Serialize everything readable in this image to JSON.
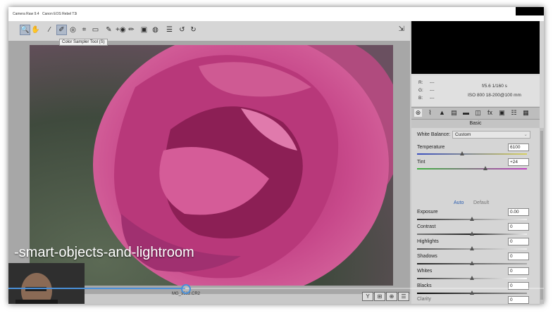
{
  "window": {
    "app_title": "Camera Raw 9.4",
    "camera_title": "Canon EOS Rebel T3i"
  },
  "toolbar": {
    "tools": [
      {
        "name": "zoom-tool-icon",
        "glyph": "🔍",
        "active": true
      },
      {
        "name": "hand-tool-icon",
        "glyph": "✋",
        "active": false
      },
      {
        "name": "white-balance-tool-icon",
        "glyph": "⁄",
        "active": false
      },
      {
        "name": "color-sampler-tool-icon",
        "glyph": "✐",
        "active": true
      },
      {
        "name": "targeted-adjustment-tool-icon",
        "glyph": "◎",
        "active": false
      },
      {
        "name": "crop-tool-icon",
        "glyph": "⌗",
        "active": false
      },
      {
        "name": "straighten-tool-icon",
        "glyph": "▭",
        "active": false
      },
      {
        "name": "spot-removal-tool-icon",
        "glyph": "✎",
        "active": false
      },
      {
        "name": "red-eye-tool-icon",
        "glyph": "+◉",
        "active": false
      },
      {
        "name": "adjustment-brush-icon",
        "glyph": "✏",
        "active": false
      },
      {
        "name": "graduated-filter-icon",
        "glyph": "▣",
        "active": false
      },
      {
        "name": "radial-filter-icon",
        "glyph": "◍",
        "active": false
      },
      {
        "name": "preferences-icon",
        "glyph": "☰",
        "active": false
      },
      {
        "name": "rotate-left-icon",
        "glyph": "↺",
        "active": false
      },
      {
        "name": "rotate-right-icon",
        "glyph": "↻",
        "active": false
      }
    ],
    "tooltip": "Color Sampler Tool (S)"
  },
  "overlay": {
    "caption": "-smart-objects-and-lightroom",
    "progress_fraction": 0.33
  },
  "footer": {
    "filename": "MG_3532.CR2",
    "icons": [
      "Y",
      "⊞",
      "⊕",
      "☰"
    ]
  },
  "readout": {
    "r_label": "R:",
    "g_label": "G:",
    "b_label": "B:",
    "r_val": "---",
    "g_val": "---",
    "b_val": "---",
    "aperture_shutter": "f/5.6   1/160 s",
    "iso_lens": "ISO 800   18-200@100 mm"
  },
  "panel_tabs": [
    "⊛",
    "⌇",
    "▲",
    "▤",
    "▬",
    "◫",
    "fx",
    "▣",
    "☷",
    "▦"
  ],
  "basic": {
    "title": "Basic",
    "white_balance_label": "White Balance:",
    "white_balance_value": "Custom",
    "temperature_label": "Temperature",
    "temperature_value": "6100",
    "tint_label": "Tint",
    "tint_value": "+24",
    "auto_label": "Auto",
    "default_label": "Default",
    "exposure_label": "Exposure",
    "exposure_value": "0.00",
    "contrast_label": "Contrast",
    "contrast_value": "0",
    "highlights_label": "Highlights",
    "highlights_value": "0",
    "shadows_label": "Shadows",
    "shadows_value": "0",
    "whites_label": "Whites",
    "whites_value": "0",
    "blacks_label": "Blacks",
    "blacks_value": "0",
    "clarity_label": "Clarity",
    "clarity_value": "0"
  },
  "colors": {
    "progress": "#4a90d9",
    "photo_pink": "#c0407a"
  }
}
